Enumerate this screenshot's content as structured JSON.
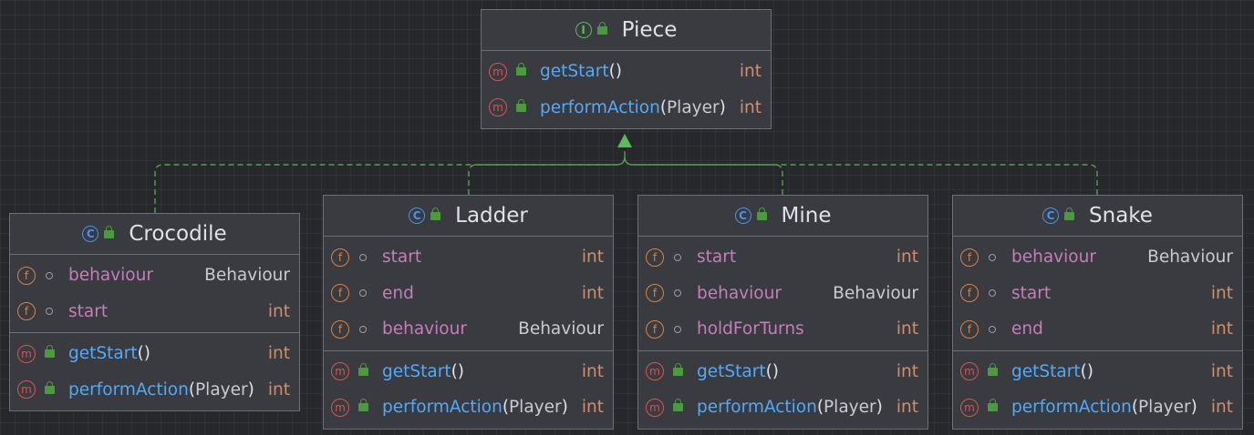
{
  "diagram": {
    "interface": {
      "name": "Piece",
      "kind_icon": "interface-icon",
      "methods": [
        {
          "name": "getStart",
          "params": "",
          "type": "int"
        },
        {
          "name": "performAction",
          "params": "Player",
          "type": "int"
        }
      ]
    },
    "classes": [
      {
        "name": "Crocodile",
        "kind_icon": "class-icon",
        "fields": [
          {
            "name": "behaviour",
            "type": "Behaviour"
          },
          {
            "name": "start",
            "type": "int"
          }
        ],
        "methods": [
          {
            "name": "getStart",
            "params": "",
            "type": "int"
          },
          {
            "name": "performAction",
            "params": "Player",
            "type": "int"
          }
        ]
      },
      {
        "name": "Ladder",
        "kind_icon": "class-icon",
        "fields": [
          {
            "name": "start",
            "type": "int"
          },
          {
            "name": "end",
            "type": "int"
          },
          {
            "name": "behaviour",
            "type": "Behaviour"
          }
        ],
        "methods": [
          {
            "name": "getStart",
            "params": "",
            "type": "int"
          },
          {
            "name": "performAction",
            "params": "Player",
            "type": "int"
          }
        ]
      },
      {
        "name": "Mine",
        "kind_icon": "class-icon",
        "fields": [
          {
            "name": "start",
            "type": "int"
          },
          {
            "name": "behaviour",
            "type": "Behaviour"
          },
          {
            "name": "holdForTurns",
            "type": "int"
          }
        ],
        "methods": [
          {
            "name": "getStart",
            "params": "",
            "type": "int"
          },
          {
            "name": "performAction",
            "params": "Player",
            "type": "int"
          }
        ]
      },
      {
        "name": "Snake",
        "kind_icon": "class-icon",
        "fields": [
          {
            "name": "behaviour",
            "type": "Behaviour"
          },
          {
            "name": "start",
            "type": "int"
          },
          {
            "name": "end",
            "type": "int"
          }
        ],
        "methods": [
          {
            "name": "getStart",
            "params": "",
            "type": "int"
          },
          {
            "name": "performAction",
            "params": "Player",
            "type": "int"
          }
        ]
      }
    ],
    "badges": {
      "interface": "I",
      "class": "C",
      "field": "f",
      "method": "m"
    },
    "colors": {
      "background": "#27282b",
      "node": "#393b40",
      "edge": "#5fb85f",
      "field_name": "#c77dbb",
      "method_name": "#56a8f5",
      "primitive_type": "#cf8e6d"
    }
  }
}
